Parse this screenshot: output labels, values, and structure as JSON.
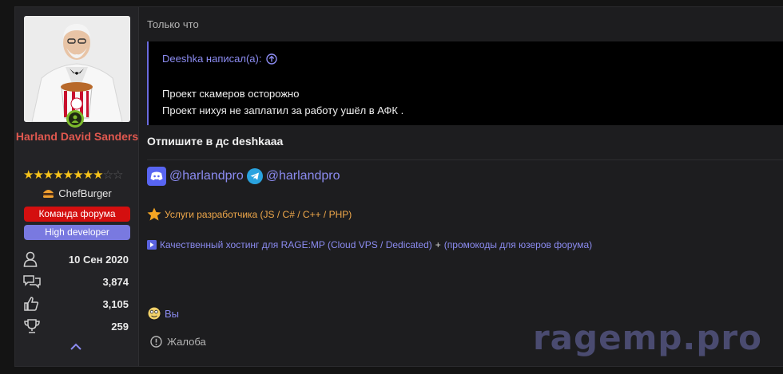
{
  "user": {
    "name": "Harland David Sanders",
    "rating_stars": 8,
    "rating_max": 10,
    "user_title": "ChefBurger",
    "banners": [
      "Команда форума",
      "High developer"
    ],
    "stats": [
      {
        "icon": "user-icon",
        "value": "10 Сен 2020"
      },
      {
        "icon": "messages-icon",
        "value": "3,874"
      },
      {
        "icon": "thumbs-up-icon",
        "value": "3,105"
      },
      {
        "icon": "trophy-icon",
        "value": "259"
      }
    ]
  },
  "post": {
    "date": "Только что",
    "quote": {
      "author_line": "Deeshka написал(а):",
      "lines": [
        "Проект скамеров осторожно",
        "Проект нихуя не заплатил за работу ушёл в АФК ."
      ]
    },
    "reply": "Отпишите в дс deshkaaa"
  },
  "signature": {
    "discord": "@harlandpro",
    "telegram": "@harlandpro",
    "services": "Услуги разработчика (JS / C# / C++ / PHP)",
    "hosting": "Качественный хостинг для RAGE:MP (Cloud VPS / Dedicated)",
    "plus": "+",
    "promo": "(промокоды для юзеров форума)"
  },
  "reactions": {
    "who": "Вы"
  },
  "actions": {
    "report": "Жалоба"
  },
  "watermark": "ragemp.pro",
  "colors": {
    "accent": "#8b8bf0",
    "username": "#e0584f",
    "staff_badge": "#d40f0f",
    "dev_badge": "#7979e0",
    "star": "#f5c21b",
    "services": "#f0a84a"
  }
}
